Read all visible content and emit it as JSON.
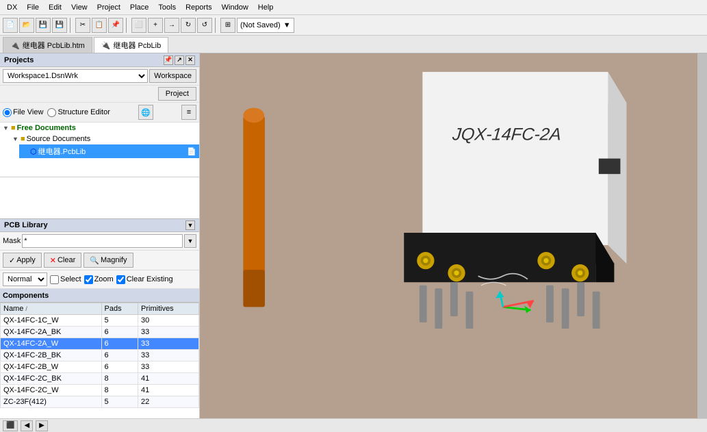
{
  "menubar": {
    "items": [
      "DX",
      "File",
      "Edit",
      "View",
      "Project",
      "Place",
      "Tools",
      "Reports",
      "Window",
      "Help"
    ]
  },
  "toolbar": {
    "save_status": "(Not Saved)",
    "dropdown_arrow": "▼"
  },
  "tabs": [
    {
      "label": "继电器 PcbLib.htm",
      "active": false
    },
    {
      "label": "继电器 PcbLib",
      "active": true
    }
  ],
  "projects": {
    "title": "Projects",
    "workspace_value": "Workspace1.DsnWrk",
    "workspace_btn": "Workspace",
    "project_btn": "Project",
    "file_view_label": "File View",
    "structure_editor_label": "Structure Editor"
  },
  "tree": {
    "items": [
      {
        "label": "Free Documents",
        "level": 0,
        "type": "folder",
        "expanded": true
      },
      {
        "label": "Source Documents",
        "level": 1,
        "type": "folder",
        "expanded": true
      },
      {
        "label": "继电器.PcbLib",
        "level": 2,
        "type": "file",
        "selected": true
      }
    ]
  },
  "pcblib": {
    "title": "PCB Library",
    "mask_label": "Mask",
    "mask_value": "*",
    "apply_btn": "Apply",
    "clear_btn": "Clear",
    "magnify_btn": "Magnify",
    "normal_label": "Normal",
    "select_label": "Select",
    "zoom_label": "Zoom",
    "clear_existing_label": "Clear Existing",
    "components_header": "Components",
    "columns": [
      {
        "label": "Name",
        "sort": "/"
      },
      {
        "label": "Pads"
      },
      {
        "label": "Primitives"
      }
    ],
    "rows": [
      {
        "name": "QX-14FC-1C_W",
        "pads": "5",
        "primitives": "30",
        "selected": false
      },
      {
        "name": "QX-14FC-2A_BK",
        "pads": "6",
        "primitives": "33",
        "selected": false
      },
      {
        "name": "QX-14FC-2A_W",
        "pads": "6",
        "primitives": "33",
        "selected": true
      },
      {
        "name": "QX-14FC-2B_BK",
        "pads": "6",
        "primitives": "33",
        "selected": false
      },
      {
        "name": "QX-14FC-2B_W",
        "pads": "6",
        "primitives": "33",
        "selected": false
      },
      {
        "name": "QX-14FC-2C_BK",
        "pads": "8",
        "primitives": "41",
        "selected": false
      },
      {
        "name": "QX-14FC-2C_W",
        "pads": "8",
        "primitives": "41",
        "selected": false
      },
      {
        "name": "ZC-23F(412)",
        "pads": "5",
        "primitives": "22",
        "selected": false
      }
    ]
  },
  "component_3d": {
    "label": "JQX-14FC-2A",
    "color_body": "#f0f0f0",
    "color_base": "#1a1a1a"
  },
  "status": {
    "text": ""
  }
}
